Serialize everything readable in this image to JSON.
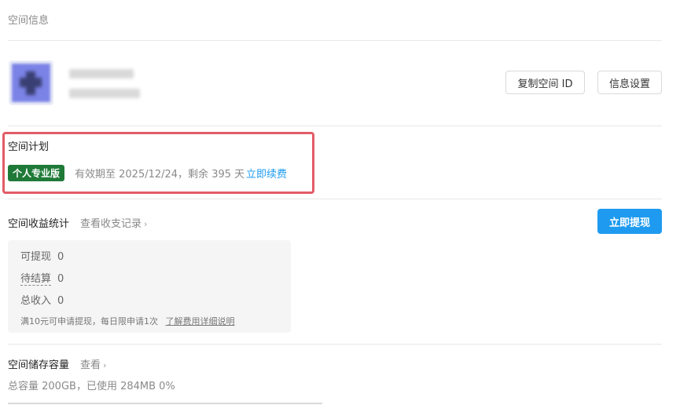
{
  "header": {
    "title": "空间信息"
  },
  "profile": {
    "copy_id_button": "复制空间 ID",
    "settings_button": "信息设置"
  },
  "plan": {
    "title": "空间计划",
    "badge": "个人专业版",
    "validity": "有效期至 2025/12/24，剩余 395 天",
    "renew_link": "立即续费"
  },
  "income": {
    "title": "空间收益统计",
    "records_link": "查看收支记录",
    "withdraw_button": "立即提现",
    "rows": [
      {
        "label": "可提现",
        "value": "0"
      },
      {
        "label": "待结算",
        "value": "0"
      },
      {
        "label": "总收入",
        "value": "0"
      }
    ],
    "note": "满10元可申请提现，每日限申请1次",
    "fee_link": "了解费用详细说明"
  },
  "storage": {
    "title": "空间储存容量",
    "view_link": "查看",
    "summary": "总容量 200GB，已使用 284MB 0%",
    "used_fraction": 0.0
  },
  "colors": {
    "accent": "#1e9bf0",
    "badge": "#1f7a38",
    "highlight": "#e25c67",
    "avatar": "#7b83e6"
  }
}
